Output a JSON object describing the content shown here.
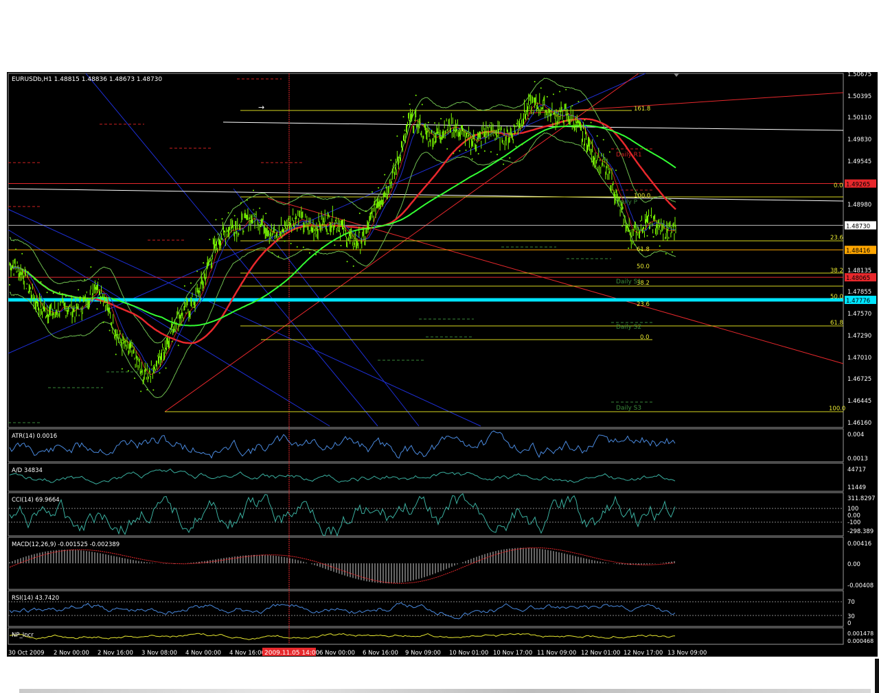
{
  "symbol_header": "EURUSDb,H1  1.48815 1.48836 1.48673 1.48730",
  "y_min": 1.4616,
  "y_max": 1.50675,
  "price_scale": {
    "ticks": [
      "1.50675",
      "1.50395",
      "1.50110",
      "1.49830",
      "1.49545",
      "1.49265",
      "1.48980",
      "1.48415",
      "1.48135",
      "1.47855",
      "1.47570",
      "1.47290",
      "1.47010",
      "1.46725",
      "1.46445",
      "1.46160"
    ],
    "labels": [
      {
        "text": "1.49265",
        "bg": "#e8282c"
      },
      {
        "text": "1.48730",
        "bg": "#ffffff"
      },
      {
        "text": "1.48416",
        "bg": "#ffa500"
      },
      {
        "text": "1.48065",
        "bg": "#e8282c"
      },
      {
        "text": "1.47776",
        "bg": "#00e5ff"
      }
    ]
  },
  "fib_labels": [
    {
      "text": "161.8",
      "color": "#e8e830"
    },
    {
      "text": "0.0",
      "color": "#e8e830"
    },
    {
      "text": "100.0",
      "color": "#e8e830"
    },
    {
      "text": "23.6",
      "color": "#e8e830"
    },
    {
      "text": "38.2",
      "color": "#e8e830"
    },
    {
      "text": "50.0",
      "color": "#e8e830"
    },
    {
      "text": "61.8",
      "color": "#e8e830"
    },
    {
      "text": "100.0",
      "color": "#e8e830"
    },
    {
      "text": "61.8",
      "color": "#e8e830"
    },
    {
      "text": "50.0",
      "color": "#e8e830"
    },
    {
      "text": "38.2",
      "color": "#e8e830"
    },
    {
      "text": "23.6",
      "color": "#e8e830"
    },
    {
      "text": "0.0",
      "color": "#e8e830"
    }
  ],
  "pivot_labels": [
    {
      "text": "Daily R1",
      "color": "#d02020"
    },
    {
      "text": "Daily P",
      "color": "#3a8a3a"
    },
    {
      "text": "Daily S1",
      "color": "#3a8a3a"
    },
    {
      "text": "Daily S2",
      "color": "#3a8a3a"
    },
    {
      "text": "Daily S3",
      "color": "#3a8a3a"
    }
  ],
  "indicators": {
    "atr": {
      "title": "ATR(14) 0.0016",
      "scale": [
        "0.004",
        "0.0013"
      ]
    },
    "ad": {
      "title": "A/D 34834",
      "scale": [
        "44717",
        "11449"
      ]
    },
    "cci": {
      "title": "CCI(14) 69.9664",
      "scale": [
        "311.8297",
        "100",
        "0.00",
        "-100",
        "-298.389"
      ]
    },
    "macd": {
      "title": "MACD(12,26,9) -0.001525 -0.002389",
      "scale": [
        "0.00416",
        "0.00",
        "-0.00408"
      ]
    },
    "rsi": {
      "title": "RSI(14) 43.7420",
      "scale": [
        "70",
        "30",
        "0"
      ]
    },
    "np": {
      "title": "NP_Incr",
      "scale": [
        "0.001478",
        "0.000468"
      ]
    }
  },
  "time_axis": [
    "30 Oct 2009",
    "2 Nov 00:00",
    "2 Nov 16:00",
    "3 Nov 08:00",
    "4 Nov 00:00",
    "4 Nov 16:00",
    "6 Nov 00:00",
    "6 Nov 16:00",
    "9 Nov 09:00",
    "10 Nov 01:00",
    "10 Nov 17:00",
    "11 Nov 09:00",
    "12 Nov 01:00",
    "12 Nov 17:00",
    "13 Nov 09:00"
  ],
  "crosshair_time": "2009.11.05 14:00",
  "colors": {
    "price": "#7cfc00",
    "bollinger": "#6fbf4f",
    "ma_fast": "#e8282c",
    "ma_slow": "#33ff33",
    "support": "#00e5ff",
    "trend_blue": "#1e2fd6",
    "trend_red": "#e8282c",
    "fib": "#e8e830",
    "grid": "#888888",
    "indicator_line": "#4a8adf"
  },
  "chart_data": {
    "type": "line",
    "title": "EURUSDb,H1",
    "xlabel": "",
    "ylabel": "",
    "ylim": [
      1.4616,
      1.50675
    ],
    "x": [
      "30 Oct 2009",
      "2 Nov 00:00",
      "2 Nov 16:00",
      "3 Nov 08:00",
      "4 Nov 00:00",
      "4 Nov 16:00",
      "5 Nov 14:00",
      "6 Nov 00:00",
      "6 Nov 16:00",
      "9 Nov 09:00",
      "10 Nov 01:00",
      "10 Nov 17:00",
      "11 Nov 09:00",
      "12 Nov 01:00",
      "12 Nov 17:00",
      "13 Nov 09:00"
    ],
    "series": [
      {
        "name": "EURUSDb",
        "values": [
          1.4822,
          1.4755,
          1.479,
          1.4675,
          1.4765,
          1.488,
          1.487,
          1.4878,
          1.4855,
          1.4998,
          1.4992,
          1.4985,
          1.503,
          1.4988,
          1.4868,
          1.4873
        ]
      }
    ],
    "horizontal_levels": [
      1.49265,
      1.4873,
      1.48416,
      1.48065,
      1.47776
    ]
  }
}
